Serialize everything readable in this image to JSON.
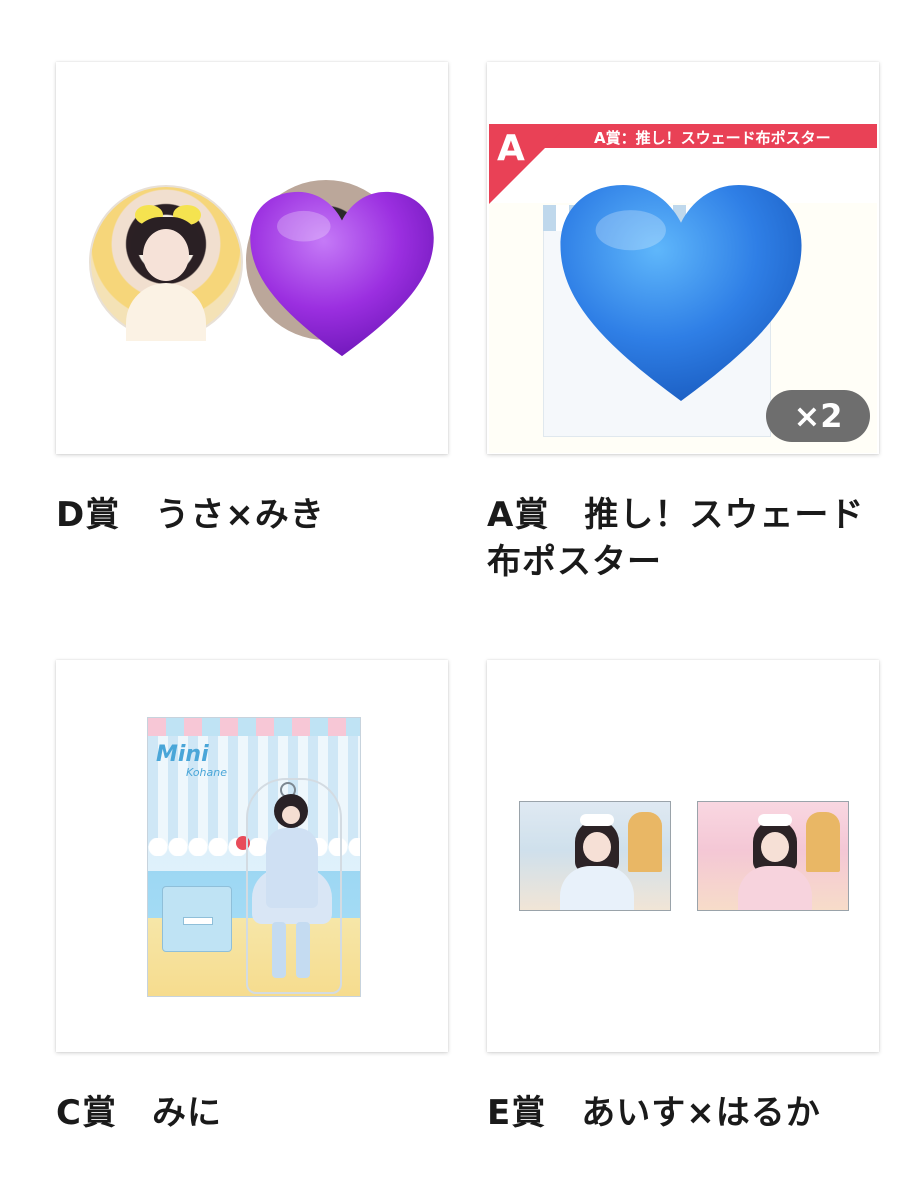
{
  "items": [
    {
      "title": "D賞　うさ×みき"
    },
    {
      "title": "A賞　推し！スウェード布ポスター",
      "banner_letter": "A",
      "banner_label": "A賞：推し！スウェード布ポスター",
      "count_badge": "×2"
    },
    {
      "title": "C賞　みに",
      "stand_logo": "Mini",
      "stand_logo_sub": "Kohane"
    },
    {
      "title": "E賞　あいす×はるか"
    }
  ],
  "overlay_icons": [
    "purple-heart-icon",
    "blue-heart-icon"
  ],
  "colors": {
    "banner": "#e94156",
    "purple_heart": "#9b2fe0",
    "blue_heart": "#2f7fe6",
    "count_pill": "#6e6e6e"
  }
}
